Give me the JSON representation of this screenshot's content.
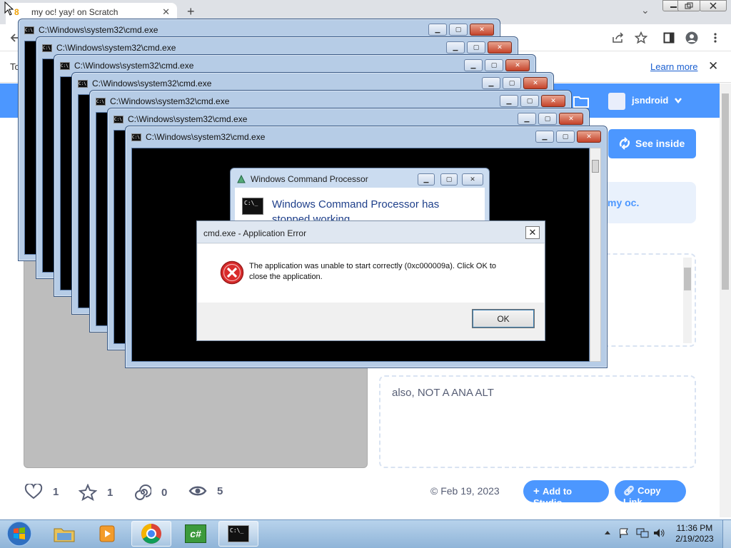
{
  "browser": {
    "tab_title": "my oc! yay! on Scratch",
    "tab_close": "✕",
    "new_tab": "+",
    "tab_list_icon": "⌄",
    "info_link": "Learn more",
    "info_close": "✕",
    "partial_text": "To"
  },
  "scratch": {
    "username": "jsndroid",
    "see_inside": "See inside",
    "instructions_partial": "my oc.",
    "notes_text": "also, NOT A ANA ALT",
    "stats": {
      "loves": "1",
      "favorites": "1",
      "remixes": "0",
      "views": "5"
    },
    "date": "© Feb 19, 2023",
    "add_to_studio": "Add to Studio",
    "copy_link": "Copy Link",
    "accent": "#4c97ff"
  },
  "cmd_windows": {
    "title": "C:\\Windows\\system32\\cmd.exe"
  },
  "wcp_dialog": {
    "title": "Windows Command Processor",
    "message": "Windows Command Processor has stopped working"
  },
  "error_dialog": {
    "title": "cmd.exe - Application Error",
    "message_line1": "The application was unable to start correctly (0xc000009a). Click OK to",
    "message_line2": "close the application.",
    "ok": "OK",
    "close": "✕"
  },
  "taskbar": {
    "time": "11:36 PM",
    "date": "2/19/2023",
    "cmd_icon_text": "C:\\_",
    "csharp_text": "c#"
  }
}
